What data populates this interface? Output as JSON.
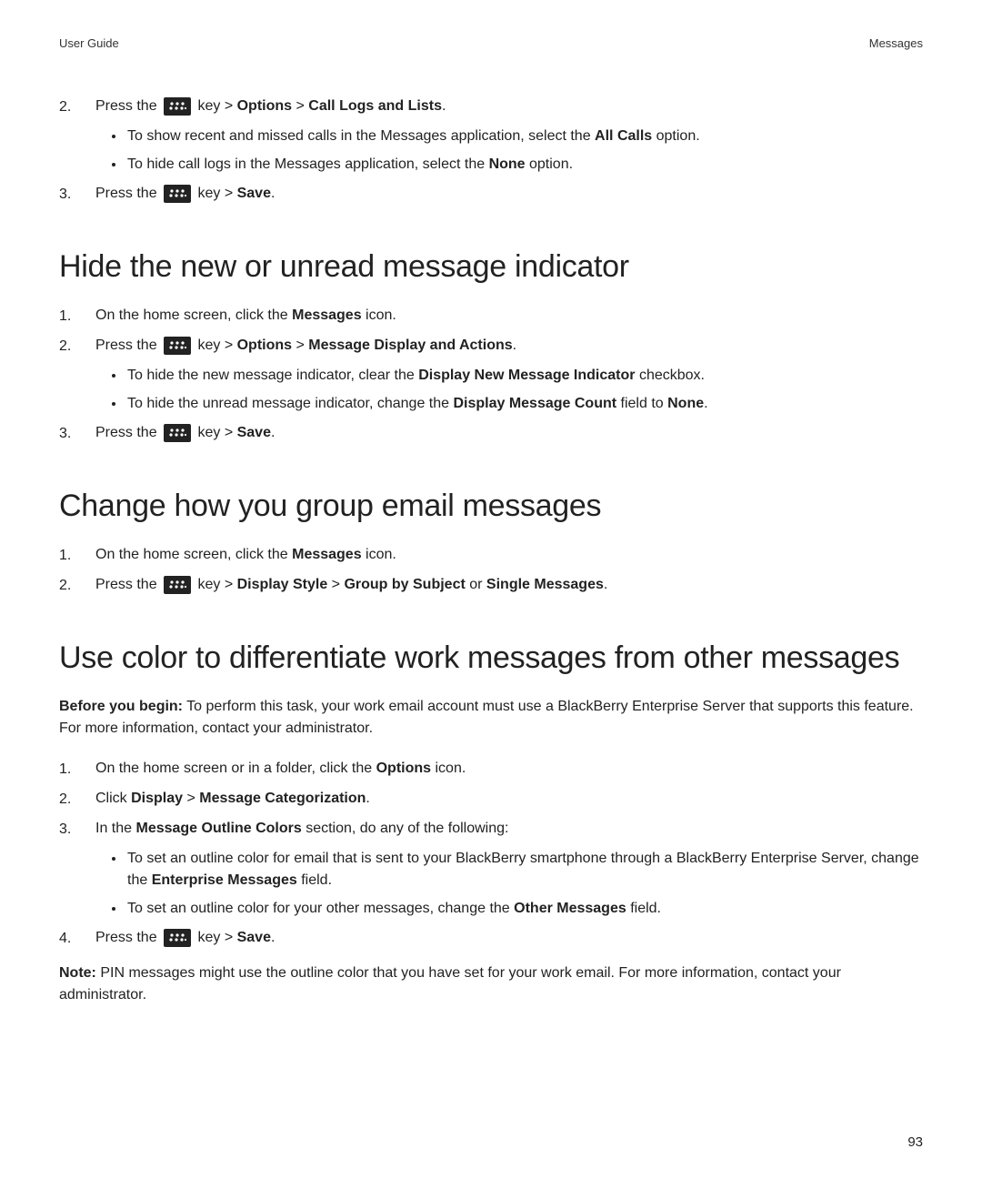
{
  "header": {
    "left": "User Guide",
    "right": "Messages"
  },
  "page_number": "93",
  "sec0": {
    "step2": {
      "num": "2.",
      "text_a": "Press the ",
      "text_b": " key > ",
      "options": "Options",
      "text_c": " > ",
      "call_logs": "Call Logs and Lists",
      "text_d": ".",
      "bullets": [
        {
          "pre": "To show recent and missed calls in the Messages application, select the ",
          "bold": "All Calls",
          "post": " option."
        },
        {
          "pre": "To hide call logs in the Messages application, select the ",
          "bold": "None",
          "post": " option."
        }
      ]
    },
    "step3": {
      "num": "3.",
      "text_a": "Press the ",
      "text_b": " key > ",
      "save": "Save",
      "text_c": "."
    }
  },
  "sec1": {
    "title": "Hide the new or unread message indicator",
    "steps": {
      "s1": {
        "num": "1.",
        "pre": "On the home screen, click the ",
        "bold": "Messages",
        "post": " icon."
      },
      "s2": {
        "num": "2.",
        "a": "Press the ",
        "b": " key > ",
        "opt": "Options",
        "c": " > ",
        "mda": "Message Display and Actions",
        "d": ".",
        "bullets": [
          {
            "pre": "To hide the new message indicator, clear the ",
            "bold": "Display New Message Indicator",
            "post": " checkbox."
          },
          {
            "pre": "To hide the unread message indicator, change the ",
            "bold": "Display Message Count",
            "mid": " field to ",
            "bold2": "None",
            "post": "."
          }
        ]
      },
      "s3": {
        "num": "3.",
        "a": "Press the ",
        "b": " key > ",
        "save": "Save",
        "c": "."
      }
    }
  },
  "sec2": {
    "title": "Change how you group email messages",
    "s1": {
      "num": "1.",
      "pre": "On the home screen, click the ",
      "bold": "Messages",
      "post": " icon."
    },
    "s2": {
      "num": "2.",
      "a": "Press the ",
      "b": " key > ",
      "ds": "Display Style",
      "c": " > ",
      "gbs": "Group by Subject",
      "or": " or ",
      "sm": "Single Messages",
      "d": "."
    }
  },
  "sec3": {
    "title": "Use color to differentiate work messages from other messages",
    "intro": {
      "label": "Before you begin:",
      "text": " To perform this task, your work email account must use a BlackBerry Enterprise Server that supports this feature. For more information, contact your administrator."
    },
    "s1": {
      "num": "1.",
      "pre": "On the home screen or in a folder, click the ",
      "bold": "Options",
      "post": " icon."
    },
    "s2": {
      "num": "2.",
      "pre": "Click ",
      "b1": "Display",
      "mid": " > ",
      "b2": "Message Categorization",
      "post": "."
    },
    "s3": {
      "num": "3.",
      "pre": "In the ",
      "bold": "Message Outline Colors",
      "post": " section, do any of the following:",
      "bullets": [
        {
          "pre": "To set an outline color for email that is sent to your BlackBerry smartphone through a BlackBerry Enterprise Server, change the ",
          "bold": "Enterprise Messages",
          "post": " field."
        },
        {
          "pre": "To set an outline color for your other messages, change the ",
          "bold": "Other Messages",
          "post": " field."
        }
      ]
    },
    "s4": {
      "num": "4.",
      "a": "Press the ",
      "b": " key > ",
      "save": "Save",
      "c": "."
    },
    "note": {
      "label": "Note:",
      "text": " PIN messages might use the outline color that you have set for your work email. For more information, contact your administrator."
    }
  }
}
